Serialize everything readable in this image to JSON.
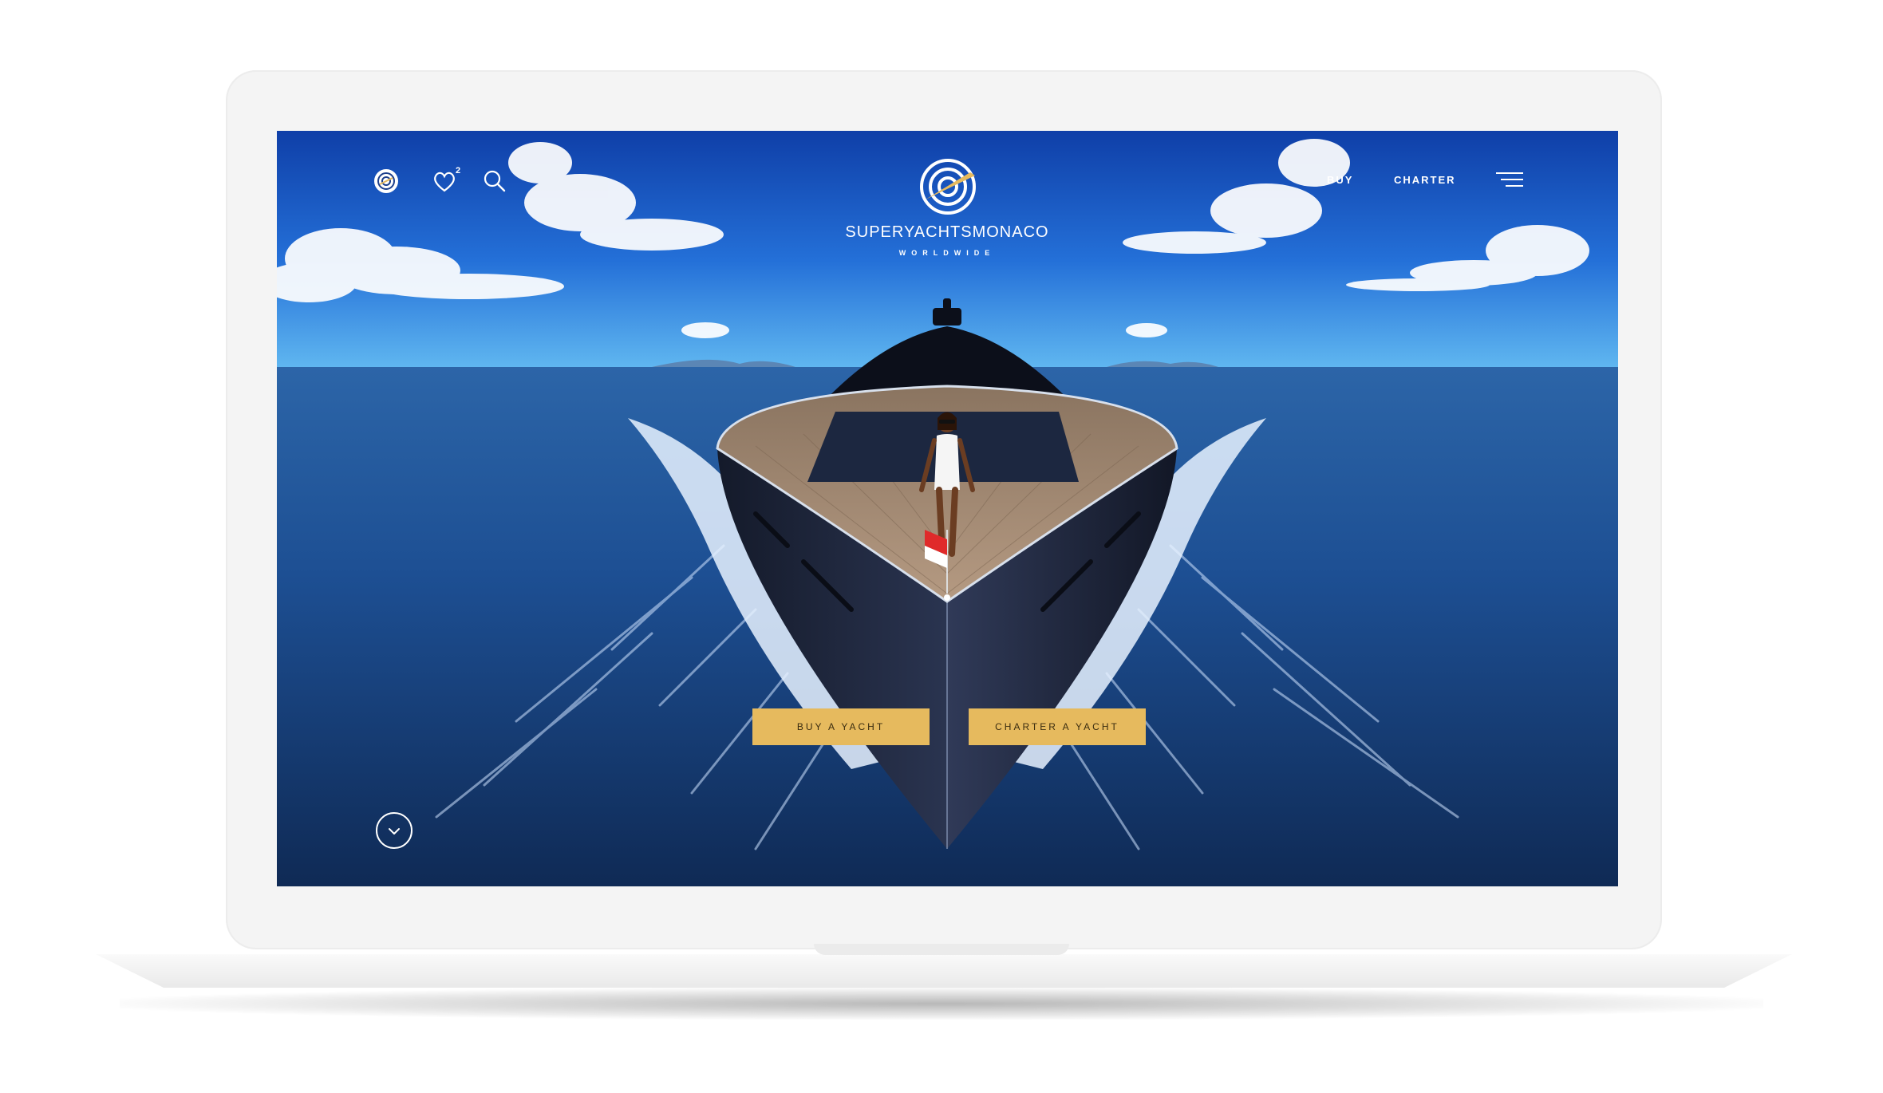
{
  "brand": {
    "name": "SUPERYACHTSMONACO",
    "tagline": "WORLDWIDE"
  },
  "header": {
    "favorites_count": "2",
    "nav": {
      "buy": "BUY",
      "charter": "CHARTER"
    }
  },
  "hero": {
    "buttons": {
      "buy": "BUY A YACHT",
      "charter": "CHARTER A YACHT"
    }
  },
  "icons": [
    "logo-icon",
    "heart-icon",
    "search-icon",
    "menu-icon",
    "chevron-down-icon"
  ],
  "colors": {
    "accent": "#e6ba5e",
    "sky": "#1547b8",
    "sea": "#1b4a8a"
  }
}
